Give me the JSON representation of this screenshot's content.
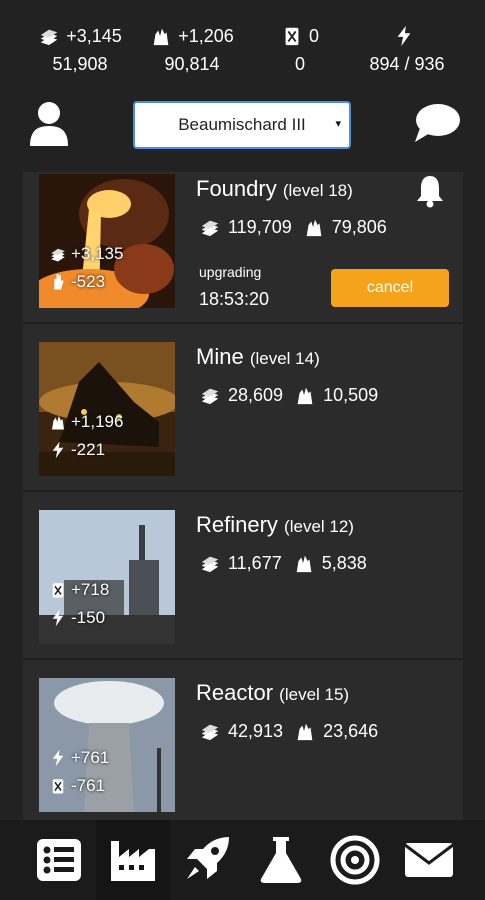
{
  "resources": [
    {
      "key": "metal",
      "icon": "metal-bars-icon",
      "rate": "+3,145",
      "total": "51,908"
    },
    {
      "key": "crystal",
      "icon": "crystal-icon",
      "rate": "+1,206",
      "total": "90,814"
    },
    {
      "key": "fuel",
      "icon": "fuel-can-icon",
      "rate": "0",
      "total": "0"
    },
    {
      "key": "energy",
      "icon": "lightning-icon",
      "rate": "",
      "total": "894 / 936"
    }
  ],
  "header": {
    "base_name": "Beaumischard III",
    "caret": "▾"
  },
  "buildings": [
    {
      "name": "Foundry",
      "level": "(level 18)",
      "prod": [
        {
          "icon": "metal-bars-icon",
          "value": "+3,135"
        },
        {
          "icon": "hand-icon",
          "value": "-523"
        }
      ],
      "cost_metal": "119,709",
      "cost_crystal": "79,806",
      "upgrading_label": "upgrading",
      "timer": "18:53:20",
      "cancel_label": "cancel"
    },
    {
      "name": "Mine",
      "level": "(level 14)",
      "prod": [
        {
          "icon": "crystal-icon",
          "value": "+1,196"
        },
        {
          "icon": "lightning-icon",
          "value": "-221"
        }
      ],
      "cost_metal": "28,609",
      "cost_crystal": "10,509"
    },
    {
      "name": "Refinery",
      "level": "(level 12)",
      "prod": [
        {
          "icon": "fuel-can-icon",
          "value": "+718"
        },
        {
          "icon": "lightning-icon",
          "value": "-150"
        }
      ],
      "cost_metal": "11,677",
      "cost_crystal": "5,838"
    },
    {
      "name": "Reactor",
      "level": "(level 15)",
      "prod": [
        {
          "icon": "lightning-icon",
          "value": "+761"
        },
        {
          "icon": "fuel-can-icon",
          "value": "-761"
        }
      ],
      "cost_metal": "42,913",
      "cost_crystal": "23,646"
    }
  ],
  "nav": [
    {
      "icon": "list-icon"
    },
    {
      "icon": "factory-icon",
      "active": true
    },
    {
      "icon": "rocket-icon"
    },
    {
      "icon": "flask-icon"
    },
    {
      "icon": "galaxy-icon"
    },
    {
      "icon": "mail-icon"
    }
  ],
  "colors": {
    "accent": "#f5a31a",
    "background": "#222222",
    "card": "#2b2b2b",
    "select_border": "#4a90d9"
  }
}
